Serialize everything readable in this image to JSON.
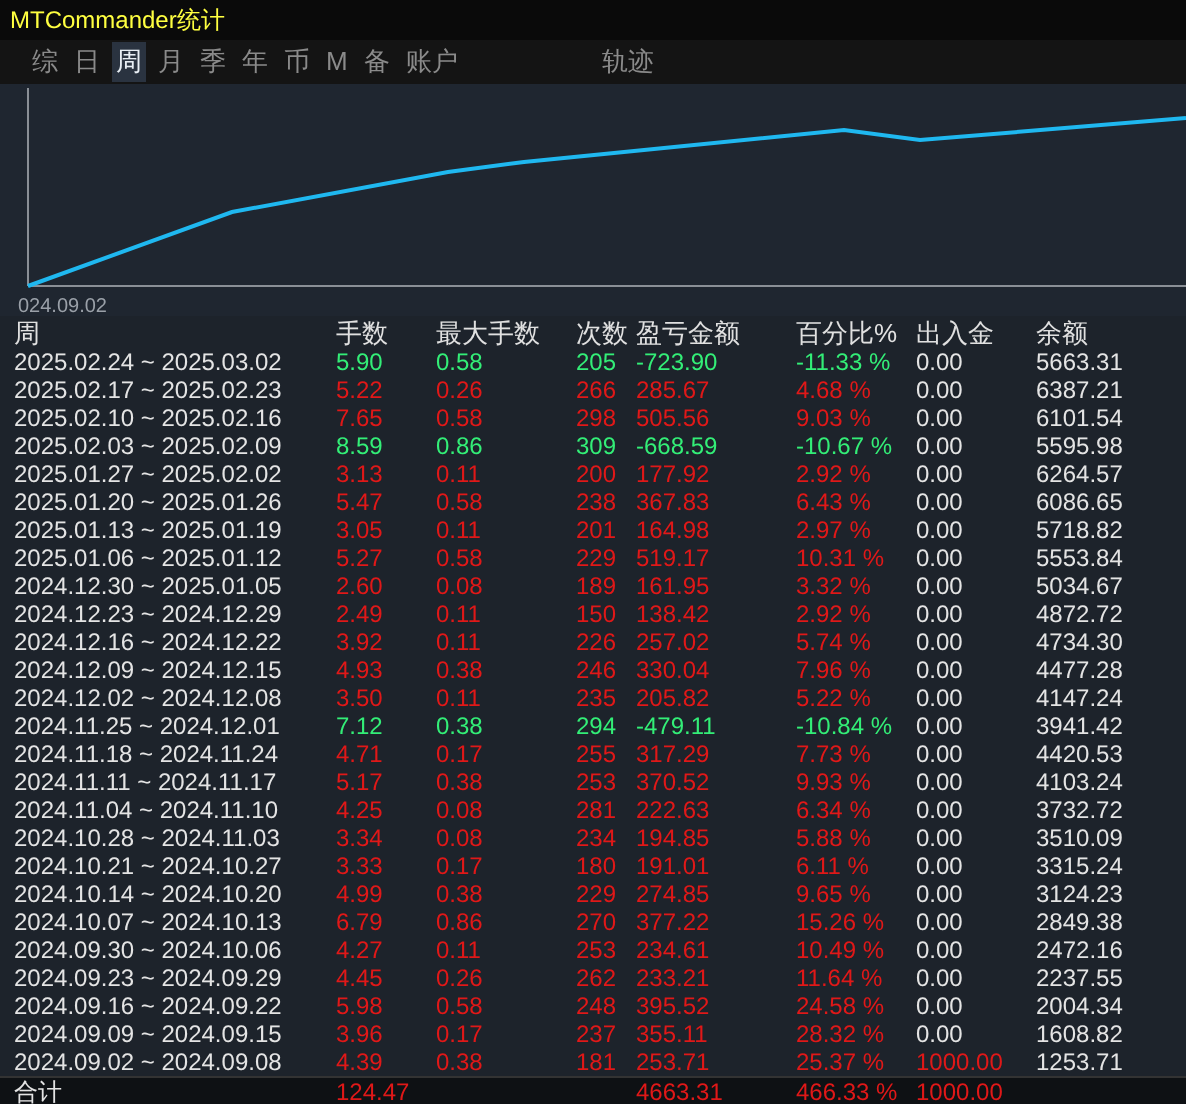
{
  "window": {
    "title": "MTCommander统计"
  },
  "tabs": [
    {
      "label": "综",
      "selected": false
    },
    {
      "label": "日",
      "selected": false
    },
    {
      "label": "周",
      "selected": true
    },
    {
      "label": "月",
      "selected": false
    },
    {
      "label": "季",
      "selected": false
    },
    {
      "label": "年",
      "selected": false
    },
    {
      "label": "币",
      "selected": false
    },
    {
      "label": "M",
      "selected": false
    },
    {
      "label": "备",
      "selected": false
    },
    {
      "label": "账户",
      "selected": false
    },
    {
      "label": "轨迹",
      "selected": false
    }
  ],
  "chart": {
    "x_label": "024.09.02"
  },
  "table": {
    "columns": [
      "周",
      "手数",
      "最大手数",
      "次数",
      "盈亏金额",
      "百分比%",
      "出入金",
      "余额"
    ],
    "rows": [
      {
        "cells": [
          "2025.02.24 ~ 2025.03.02",
          "5.90",
          "0.58",
          "205",
          "-723.90",
          "-11.33 %",
          "0.00",
          "5663.31"
        ],
        "color": "#33ee77",
        "deposit_highlight": false
      },
      {
        "cells": [
          "2025.02.17 ~ 2025.02.23",
          "5.22",
          "0.26",
          "266",
          "285.67",
          "4.68 %",
          "0.00",
          "6387.21"
        ],
        "color": "#e01818",
        "deposit_highlight": false
      },
      {
        "cells": [
          "2025.02.10 ~ 2025.02.16",
          "7.65",
          "0.58",
          "298",
          "505.56",
          "9.03 %",
          "0.00",
          "6101.54"
        ],
        "color": "#e01818",
        "deposit_highlight": false
      },
      {
        "cells": [
          "2025.02.03 ~ 2025.02.09",
          "8.59",
          "0.86",
          "309",
          "-668.59",
          "-10.67 %",
          "0.00",
          "5595.98"
        ],
        "color": "#33ee77",
        "deposit_highlight": false
      },
      {
        "cells": [
          "2025.01.27 ~ 2025.02.02",
          "3.13",
          "0.11",
          "200",
          "177.92",
          "2.92 %",
          "0.00",
          "6264.57"
        ],
        "color": "#e01818",
        "deposit_highlight": false
      },
      {
        "cells": [
          "2025.01.20 ~ 2025.01.26",
          "5.47",
          "0.58",
          "238",
          "367.83",
          "6.43 %",
          "0.00",
          "6086.65"
        ],
        "color": "#e01818",
        "deposit_highlight": false
      },
      {
        "cells": [
          "2025.01.13 ~ 2025.01.19",
          "3.05",
          "0.11",
          "201",
          "164.98",
          "2.97 %",
          "0.00",
          "5718.82"
        ],
        "color": "#e01818",
        "deposit_highlight": false
      },
      {
        "cells": [
          "2025.01.06 ~ 2025.01.12",
          "5.27",
          "0.58",
          "229",
          "519.17",
          "10.31 %",
          "0.00",
          "5553.84"
        ],
        "color": "#e01818",
        "deposit_highlight": false
      },
      {
        "cells": [
          "2024.12.30 ~ 2025.01.05",
          "2.60",
          "0.08",
          "189",
          "161.95",
          "3.32 %",
          "0.00",
          "5034.67"
        ],
        "color": "#e01818",
        "deposit_highlight": false
      },
      {
        "cells": [
          "2024.12.23 ~ 2024.12.29",
          "2.49",
          "0.11",
          "150",
          "138.42",
          "2.92 %",
          "0.00",
          "4872.72"
        ],
        "color": "#e01818",
        "deposit_highlight": false
      },
      {
        "cells": [
          "2024.12.16 ~ 2024.12.22",
          "3.92",
          "0.11",
          "226",
          "257.02",
          "5.74 %",
          "0.00",
          "4734.30"
        ],
        "color": "#e01818",
        "deposit_highlight": false
      },
      {
        "cells": [
          "2024.12.09 ~ 2024.12.15",
          "4.93",
          "0.38",
          "246",
          "330.04",
          "7.96 %",
          "0.00",
          "4477.28"
        ],
        "color": "#e01818",
        "deposit_highlight": false
      },
      {
        "cells": [
          "2024.12.02 ~ 2024.12.08",
          "3.50",
          "0.11",
          "235",
          "205.82",
          "5.22 %",
          "0.00",
          "4147.24"
        ],
        "color": "#e01818",
        "deposit_highlight": false
      },
      {
        "cells": [
          "2024.11.25 ~ 2024.12.01",
          "7.12",
          "0.38",
          "294",
          "-479.11",
          "-10.84 %",
          "0.00",
          "3941.42"
        ],
        "color": "#33ee77",
        "deposit_highlight": false
      },
      {
        "cells": [
          "2024.11.18 ~ 2024.11.24",
          "4.71",
          "0.17",
          "255",
          "317.29",
          "7.73 %",
          "0.00",
          "4420.53"
        ],
        "color": "#e01818",
        "deposit_highlight": false
      },
      {
        "cells": [
          "2024.11.11 ~ 2024.11.17",
          "5.17",
          "0.38",
          "253",
          "370.52",
          "9.93 %",
          "0.00",
          "4103.24"
        ],
        "color": "#e01818",
        "deposit_highlight": false
      },
      {
        "cells": [
          "2024.11.04 ~ 2024.11.10",
          "4.25",
          "0.08",
          "281",
          "222.63",
          "6.34 %",
          "0.00",
          "3732.72"
        ],
        "color": "#e01818",
        "deposit_highlight": false
      },
      {
        "cells": [
          "2024.10.28 ~ 2024.11.03",
          "3.34",
          "0.08",
          "234",
          "194.85",
          "5.88 %",
          "0.00",
          "3510.09"
        ],
        "color": "#e01818",
        "deposit_highlight": false
      },
      {
        "cells": [
          "2024.10.21 ~ 2024.10.27",
          "3.33",
          "0.17",
          "180",
          "191.01",
          "6.11 %",
          "0.00",
          "3315.24"
        ],
        "color": "#e01818",
        "deposit_highlight": false
      },
      {
        "cells": [
          "2024.10.14 ~ 2024.10.20",
          "4.99",
          "0.38",
          "229",
          "274.85",
          "9.65 %",
          "0.00",
          "3124.23"
        ],
        "color": "#e01818",
        "deposit_highlight": false
      },
      {
        "cells": [
          "2024.10.07 ~ 2024.10.13",
          "6.79",
          "0.86",
          "270",
          "377.22",
          "15.26 %",
          "0.00",
          "2849.38"
        ],
        "color": "#e01818",
        "deposit_highlight": false
      },
      {
        "cells": [
          "2024.09.30 ~ 2024.10.06",
          "4.27",
          "0.11",
          "253",
          "234.61",
          "10.49 %",
          "0.00",
          "2472.16"
        ],
        "color": "#e01818",
        "deposit_highlight": false
      },
      {
        "cells": [
          "2024.09.23 ~ 2024.09.29",
          "4.45",
          "0.26",
          "262",
          "233.21",
          "11.64 %",
          "0.00",
          "2237.55"
        ],
        "color": "#e01818",
        "deposit_highlight": false
      },
      {
        "cells": [
          "2024.09.16 ~ 2024.09.22",
          "5.98",
          "0.58",
          "248",
          "395.52",
          "24.58 %",
          "0.00",
          "2004.34"
        ],
        "color": "#e01818",
        "deposit_highlight": false
      },
      {
        "cells": [
          "2024.09.09 ~ 2024.09.15",
          "3.96",
          "0.17",
          "237",
          "355.11",
          "28.32 %",
          "0.00",
          "1608.82"
        ],
        "color": "#e01818",
        "deposit_highlight": false
      },
      {
        "cells": [
          "2024.09.02 ~ 2024.09.08",
          "4.39",
          "0.38",
          "181",
          "253.71",
          "25.37 %",
          "1000.00",
          "1253.71"
        ],
        "color": "#e01818",
        "deposit_highlight": true
      }
    ],
    "total": {
      "label": "合计",
      "lots": "124.47",
      "profit": "4663.31",
      "percent": "466.33 %",
      "deposit": "1000.00"
    }
  }
}
